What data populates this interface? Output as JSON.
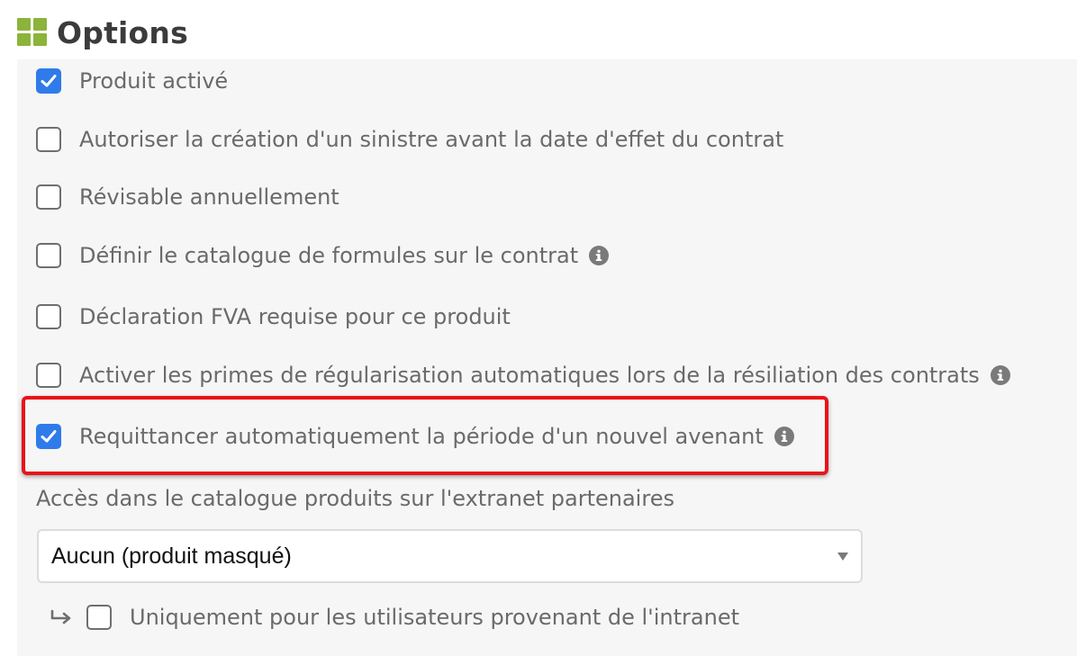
{
  "section": {
    "title": "Options",
    "icon": "grid-icon",
    "accent_color": "#8cb33a"
  },
  "options": [
    {
      "label": "Produit activé",
      "checked": true
    },
    {
      "label": "Autoriser la création d'un sinistre avant la date d'effet du contrat",
      "checked": false
    },
    {
      "label": "Révisable annuellement",
      "checked": false
    },
    {
      "label": "Définir le catalogue de formules sur le contrat",
      "checked": false,
      "info": true
    },
    {
      "label": "Déclaration FVA requise pour ce produit",
      "checked": false
    },
    {
      "label": "Activer les primes de régularisation automatiques lors de la résiliation des contrats",
      "checked": false,
      "info": true
    },
    {
      "label": "Requittancer automatiquement la période d'un nouvel avenant",
      "checked": true,
      "info": true,
      "highlighted": true
    }
  ],
  "access": {
    "label": "Accès dans le catalogue produits sur l'extranet partenaires",
    "selected": "Aucun (produit masqué)"
  },
  "sub_option": {
    "label": "Uniquement pour les utilisateurs provenant de l'intranet",
    "checked": false,
    "icon": "subdirectory-arrow-icon"
  },
  "colors": {
    "checkbox_checked": "#2f7bea",
    "highlight_border": "#e8141a"
  }
}
